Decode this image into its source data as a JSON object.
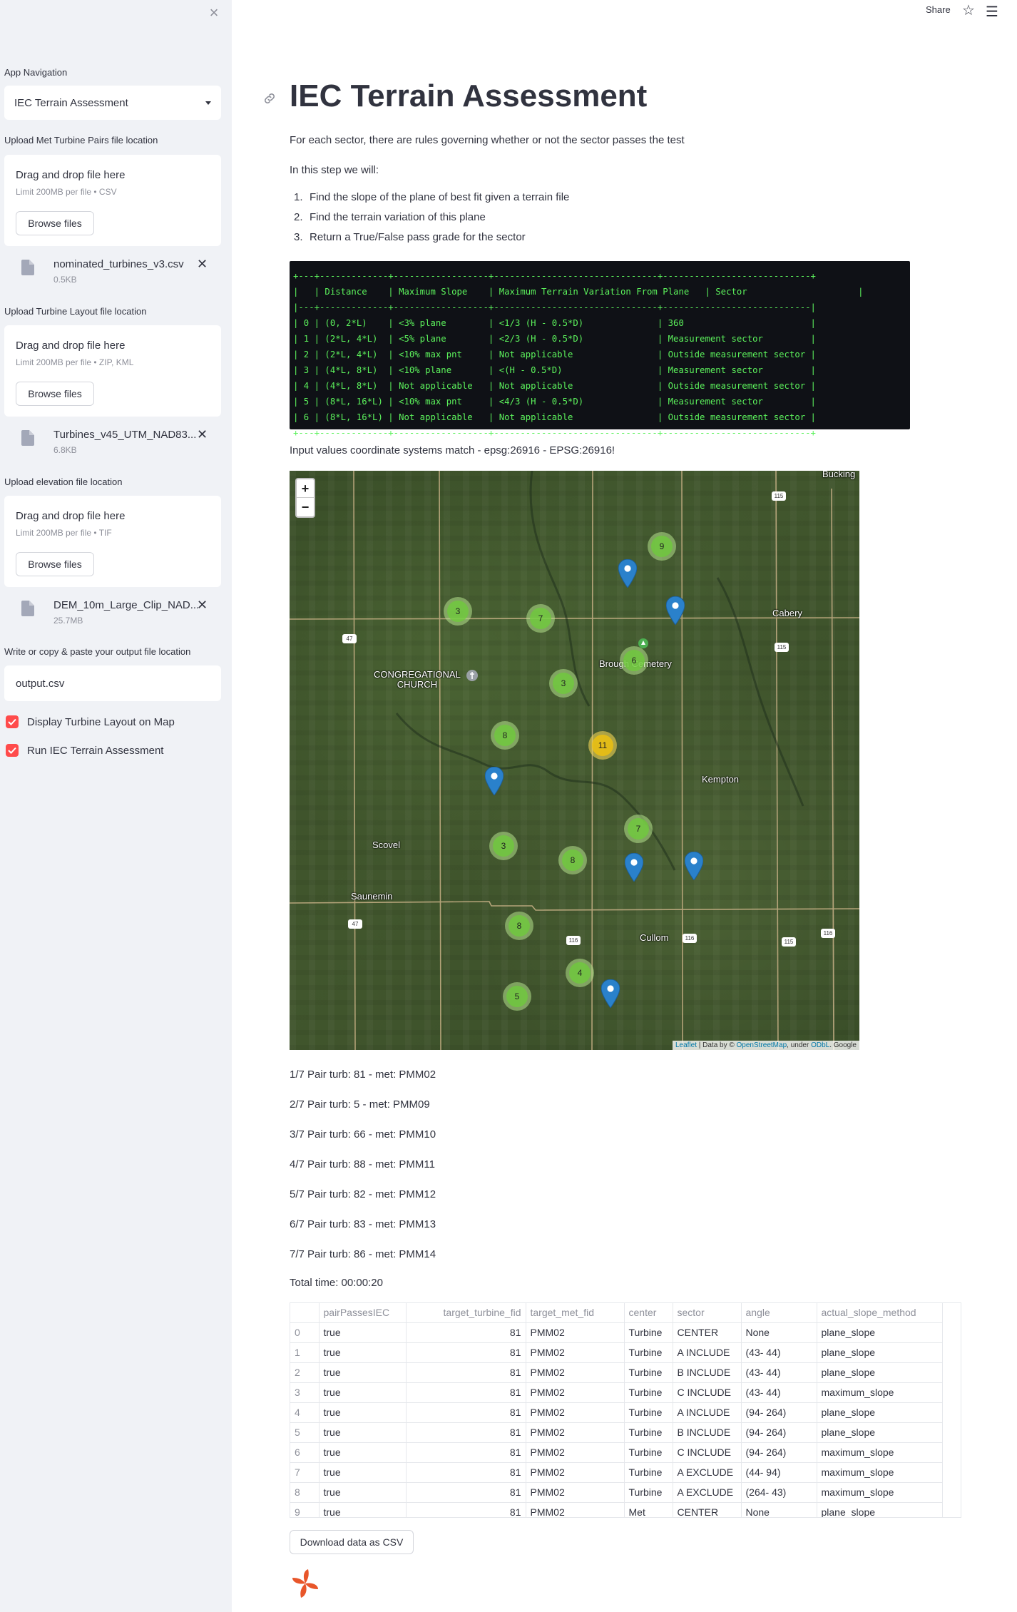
{
  "header": {
    "share_label": "Share"
  },
  "sidebar": {
    "nav_label": "App Navigation",
    "nav_selected": "IEC Terrain Assessment",
    "uploads": [
      {
        "label": "Upload Met Turbine Pairs file location",
        "drop_title": "Drag and drop file here",
        "limit": "Limit 200MB per file • CSV",
        "browse": "Browse files",
        "file_name": "nominated_turbines_v3.csv",
        "file_size": "0.5KB"
      },
      {
        "label": "Upload Turbine Layout file location",
        "drop_title": "Drag and drop file here",
        "limit": "Limit 200MB per file • ZIP, KML",
        "browse": "Browse files",
        "file_name": "Turbines_v45_UTM_NAD83...",
        "file_size": "6.8KB"
      },
      {
        "label": "Upload elevation file location",
        "drop_title": "Drag and drop file here",
        "limit": "Limit 200MB per file • TIF",
        "browse": "Browse files",
        "file_name": "DEM_10m_Large_Clip_NAD...",
        "file_size": "25.7MB"
      }
    ],
    "output_label": "Write or copy & paste your output file location",
    "output_value": "output.csv",
    "checkboxes": [
      {
        "label": "Display Turbine Layout on Map",
        "checked": true
      },
      {
        "label": "Run IEC Terrain Assessment",
        "checked": true
      }
    ]
  },
  "main": {
    "title": "IEC Terrain Assessment",
    "intro": "For each sector, there are rules governing whether or not the sector passes the test",
    "step_intro": "In this step we will:",
    "steps": [
      "Find the slope of the plane of best fit given a terrain file",
      "Find the terrain variation of this plane",
      "Return a True/False pass grade for the sector"
    ],
    "rules_table_text": "+---+-------------+------------------+-------------------------------+----------------------------+\n|   | Distance    | Maximum Slope    | Maximum Terrain Variation From Plane   | Sector                     |\n|---+-------------+------------------+-------------------------------+----------------------------|\n| 0 | (0, 2*L)    | <3% plane        | <1/3 (H - 0.5*D)              | 360                        |\n| 1 | (2*L, 4*L)  | <5% plane        | <2/3 (H - 0.5*D)              | Measurement sector         |\n| 2 | (2*L, 4*L)  | <10% max pnt     | Not applicable                | Outside measurement sector |\n| 3 | (4*L, 8*L)  | <10% plane       | <(H - 0.5*D)                  | Measurement sector         |\n| 4 | (4*L, 8*L)  | Not applicable   | Not applicable                | Outside measurement sector |\n| 5 | (8*L, 16*L) | <10% max pnt     | <4/3 (H - 0.5*D)              | Measurement sector         |\n| 6 | (8*L, 16*L) | Not applicable   | Not applicable                | Outside measurement sector |\n+---+-------------+------------------+-------------------------------+----------------------------+",
    "crs_message": "Input values coordinate systems match - epsg:26916 - EPSG:26916!",
    "pair_lines": [
      "1/7 Pair turb: 81 - met: PMM02",
      "2/7 Pair turb: 5 - met: PMM09",
      "3/7 Pair turb: 66 - met: PMM10",
      "4/7 Pair turb: 88 - met: PMM11",
      "5/7 Pair turb: 82 - met: PMM12",
      "6/7 Pair turb: 83 - met: PMM13",
      "7/7 Pair turb: 86 - met: PMM14"
    ],
    "total_time": "Total time: 00:00:20",
    "download_label": "Download data as CSV"
  },
  "map": {
    "zoom_in": "+",
    "zoom_out": "−",
    "labels": {
      "bucking": "Bucking",
      "cabery": "Cabery",
      "church": "CONGREGATIONAL\nCHURCH",
      "cemetery": "Brough   Cemetery",
      "kempton": "Kempton",
      "scovel": "Scovel",
      "saunemin": "Saunemin",
      "cullom": "Cullom"
    },
    "road_shields": [
      "115",
      "115",
      "47",
      "47",
      "116",
      "116",
      "115",
      "116"
    ],
    "clusters": [
      "9",
      "3",
      "7",
      "6",
      "3",
      "8",
      "11",
      "7",
      "3",
      "8",
      "8",
      "4",
      "5"
    ],
    "attribution": {
      "leaflet": "Leaflet",
      "sep": " | Data by © ",
      "osm": "OpenStreetMap",
      "under": ", under ",
      "odbl": "ODbL",
      "google": ". Google"
    }
  },
  "results": {
    "columns": [
      "",
      "pairPassesIEC",
      "target_turbine_fid",
      "target_met_fid",
      "center",
      "sector",
      "angle",
      "actual_slope_method"
    ],
    "rows": [
      [
        "0",
        "true",
        "81",
        "PMM02",
        "Turbine",
        "CENTER",
        "None",
        "plane_slope"
      ],
      [
        "1",
        "true",
        "81",
        "PMM02",
        "Turbine",
        "A INCLUDE",
        "(43- 44)",
        "plane_slope"
      ],
      [
        "2",
        "true",
        "81",
        "PMM02",
        "Turbine",
        "B INCLUDE",
        "(43- 44)",
        "plane_slope"
      ],
      [
        "3",
        "true",
        "81",
        "PMM02",
        "Turbine",
        "C INCLUDE",
        "(43- 44)",
        "maximum_slope"
      ],
      [
        "4",
        "true",
        "81",
        "PMM02",
        "Turbine",
        "A INCLUDE",
        "(94- 264)",
        "plane_slope"
      ],
      [
        "5",
        "true",
        "81",
        "PMM02",
        "Turbine",
        "B INCLUDE",
        "(94- 264)",
        "plane_slope"
      ],
      [
        "6",
        "true",
        "81",
        "PMM02",
        "Turbine",
        "C INCLUDE",
        "(94- 264)",
        "maximum_slope"
      ],
      [
        "7",
        "true",
        "81",
        "PMM02",
        "Turbine",
        "A EXCLUDE",
        "(44- 94)",
        "maximum_slope"
      ],
      [
        "8",
        "true",
        "81",
        "PMM02",
        "Turbine",
        "A EXCLUDE",
        "(264- 43)",
        "maximum_slope"
      ],
      [
        "9",
        "true",
        "81",
        "PMM02",
        "Met",
        "CENTER",
        "None",
        "plane_slope"
      ]
    ]
  },
  "colors": {
    "accent": "#ff4b4b",
    "sidebar_bg": "#f0f2f6",
    "code_bg": "#0f1116",
    "code_fg": "#5cf25c",
    "marker_blue": "#2a81cb"
  }
}
